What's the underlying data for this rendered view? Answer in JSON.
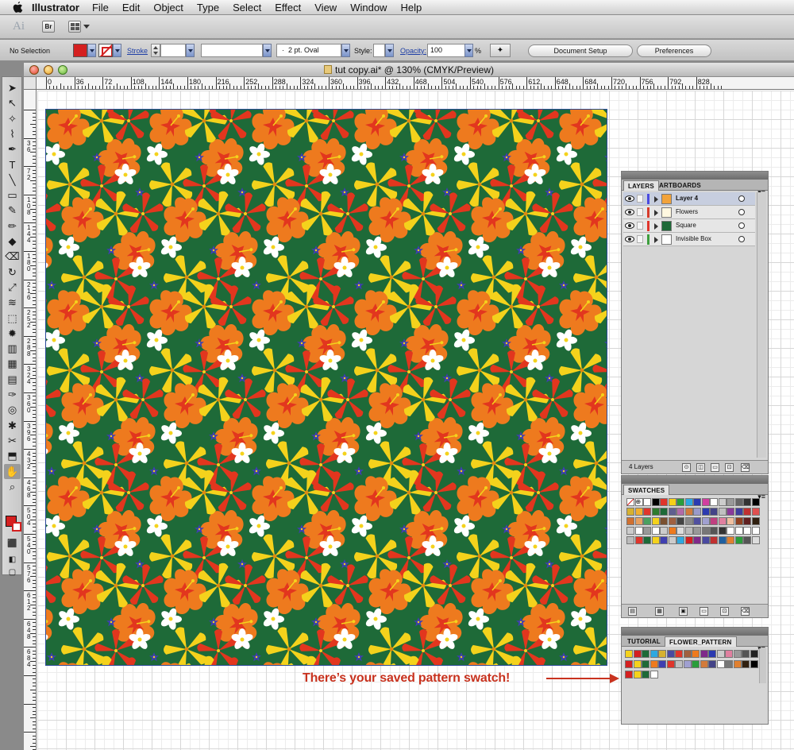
{
  "menubar": {
    "app_name": "Illustrator",
    "items": [
      "File",
      "Edit",
      "Object",
      "Type",
      "Select",
      "Effect",
      "View",
      "Window",
      "Help"
    ]
  },
  "appbar": {
    "logo_text": "Ai",
    "bridge_label": "Br"
  },
  "controlbar": {
    "selection_text": "No Selection",
    "stroke_label": "Stroke",
    "brush_value": "2 pt. Oval",
    "style_label": "Style:",
    "opacity_label": "Opacity:",
    "opacity_value": "100",
    "percent_sign": "%",
    "document_setup": "Document Setup",
    "preferences": "Preferences",
    "fill_color": "#d42020"
  },
  "document": {
    "title": "tut copy.ai* @ 130% (CMYK/Preview)",
    "ruler_h": [
      "0",
      "36",
      "72",
      "108",
      "144",
      "180",
      "216",
      "252",
      "288",
      "324",
      "360",
      "396",
      "432",
      "468",
      "504",
      "540",
      "576",
      "612",
      "648",
      "684",
      "720",
      "756",
      "792",
      "828"
    ],
    "ruler_v": [
      "3 6",
      "7 2",
      "1 0 8",
      "1 4 4",
      "1 8 0",
      "2 1 6",
      "2 5 2",
      "2 8 8",
      "3 2 4",
      "3 6 0",
      "3 9 6",
      "4 3 2",
      "4 6 8",
      "5 0 4",
      "5 4 0",
      "5 7 6",
      "6 1 2",
      "6 4 8",
      "6 8 4"
    ]
  },
  "layers_panel": {
    "tabs": [
      "LAYERS",
      "ARTBOARDS"
    ],
    "rows": [
      {
        "name": "Layer 4",
        "color": "#4a4ae0",
        "selected": true
      },
      {
        "name": "Flowers",
        "color": "#d63b2b",
        "selected": false
      },
      {
        "name": "Square",
        "color": "#e0352b",
        "selected": false
      },
      {
        "name": "Invisible Box",
        "color": "#3d9e3d",
        "selected": false
      }
    ],
    "footer_count": "4 Layers"
  },
  "swatches_panel": {
    "tabs": [
      "SWATCHES"
    ]
  },
  "library_panel": {
    "tabs": [
      "TUTORIAL",
      "FLOWER_PATTERN"
    ]
  },
  "annotation": {
    "text": "There’s your saved pattern swatch!",
    "color": "#c8321e"
  },
  "pattern_colors": {
    "background": "#1e6a38",
    "hibiscus": "#ee7a1e",
    "hibiscus_red": "#e2361e",
    "lily": "#f4d21c",
    "plumeria": "#ffffff",
    "star_flower": "#3f3fb0"
  },
  "icons": {
    "apple": "apple-icon",
    "tools": [
      "selection-tool-icon",
      "direct-selection-tool-icon",
      "magic-wand-tool-icon",
      "lasso-tool-icon",
      "pen-tool-icon",
      "type-tool-icon",
      "line-tool-icon",
      "rectangle-tool-icon",
      "paintbrush-tool-icon",
      "pencil-tool-icon",
      "blob-brush-tool-icon",
      "eraser-tool-icon",
      "rotate-tool-icon",
      "scale-tool-icon",
      "warp-tool-icon",
      "free-transform-tool-icon",
      "symbol-sprayer-tool-icon",
      "column-graph-tool-icon",
      "mesh-tool-icon",
      "gradient-tool-icon",
      "eyedropper-tool-icon",
      "blend-tool-icon",
      "live-paint-tool-icon",
      "slice-tool-icon",
      "artboard-tool-icon",
      "hand-tool-icon",
      "zoom-tool-icon"
    ]
  }
}
